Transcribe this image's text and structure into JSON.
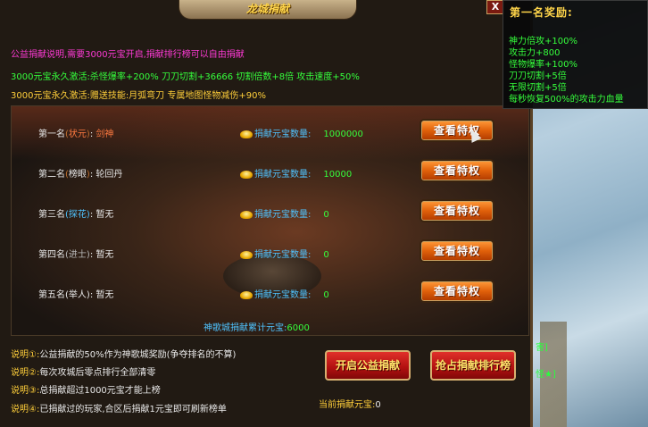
{
  "window": {
    "title": "龙城捐献",
    "close_label": "X"
  },
  "intro": {
    "line1": "公益捐献说明,需要3000元宝开启,捐献排行榜可以自由捐献",
    "line2": "3000元宝永久激活:杀怪爆率+200% 刀刀切割+36666 切割倍数+8倍 攻击速度+50%",
    "line3": "3000元宝永久激活:赠送技能:月弧弯刀 专属地图怪物减伤+90%"
  },
  "ranks": [
    {
      "rank": "第一名",
      "title": "状元",
      "name": "剑神",
      "amount_label": "捐献元宝数量:",
      "amount": "1000000",
      "button": "查看特权"
    },
    {
      "rank": "第二名",
      "title": "榜眼",
      "name": "轮回丹",
      "amount_label": "捐献元宝数量:",
      "amount": "10000",
      "button": "查看特权"
    },
    {
      "rank": "第三名",
      "title": "探花",
      "name": "暂无",
      "amount_label": "捐献元宝数量:",
      "amount": "0",
      "button": "查看特权"
    },
    {
      "rank": "第四名",
      "title": "进士",
      "name": "暂无",
      "amount_label": "捐献元宝数量:",
      "amount": "0",
      "button": "查看特权"
    },
    {
      "rank": "第五名",
      "title": "举人",
      "name": "暂无",
      "amount_label": "捐献元宝数量:",
      "amount": "0",
      "button": "查看特权"
    }
  ],
  "total": {
    "label": "神歌城捐献累计元宝:",
    "value": "6000"
  },
  "notes": [
    {
      "key": "说明①:",
      "text": "公益捐献的50%作为神歌城奖励(争夺排名的不算)"
    },
    {
      "key": "说明②:",
      "text": "每次攻城后零点排行全部清零"
    },
    {
      "key": "说明③:",
      "text": "总捐献超过1000元宝才能上榜"
    },
    {
      "key": "说明④:",
      "text": "已捐献过的玩家,合区后捐献1元宝即可刷新榜单"
    }
  ],
  "buttons": {
    "open_donation": "开启公益捐献",
    "rank_donation": "抢占捐献排行榜"
  },
  "current": {
    "label": "当前捐献元宝:",
    "value": "0"
  },
  "tooltip": {
    "title": "第一名奖励:",
    "items": [
      "神力倍攻+100%",
      "攻击力+800",
      "怪物爆率+100%",
      "刀刀切割+5倍",
      "无限切割+5倍",
      "每秒恢复500%的攻击力血量"
    ]
  },
  "map_labels": [
    "害]",
    "怪★]"
  ]
}
